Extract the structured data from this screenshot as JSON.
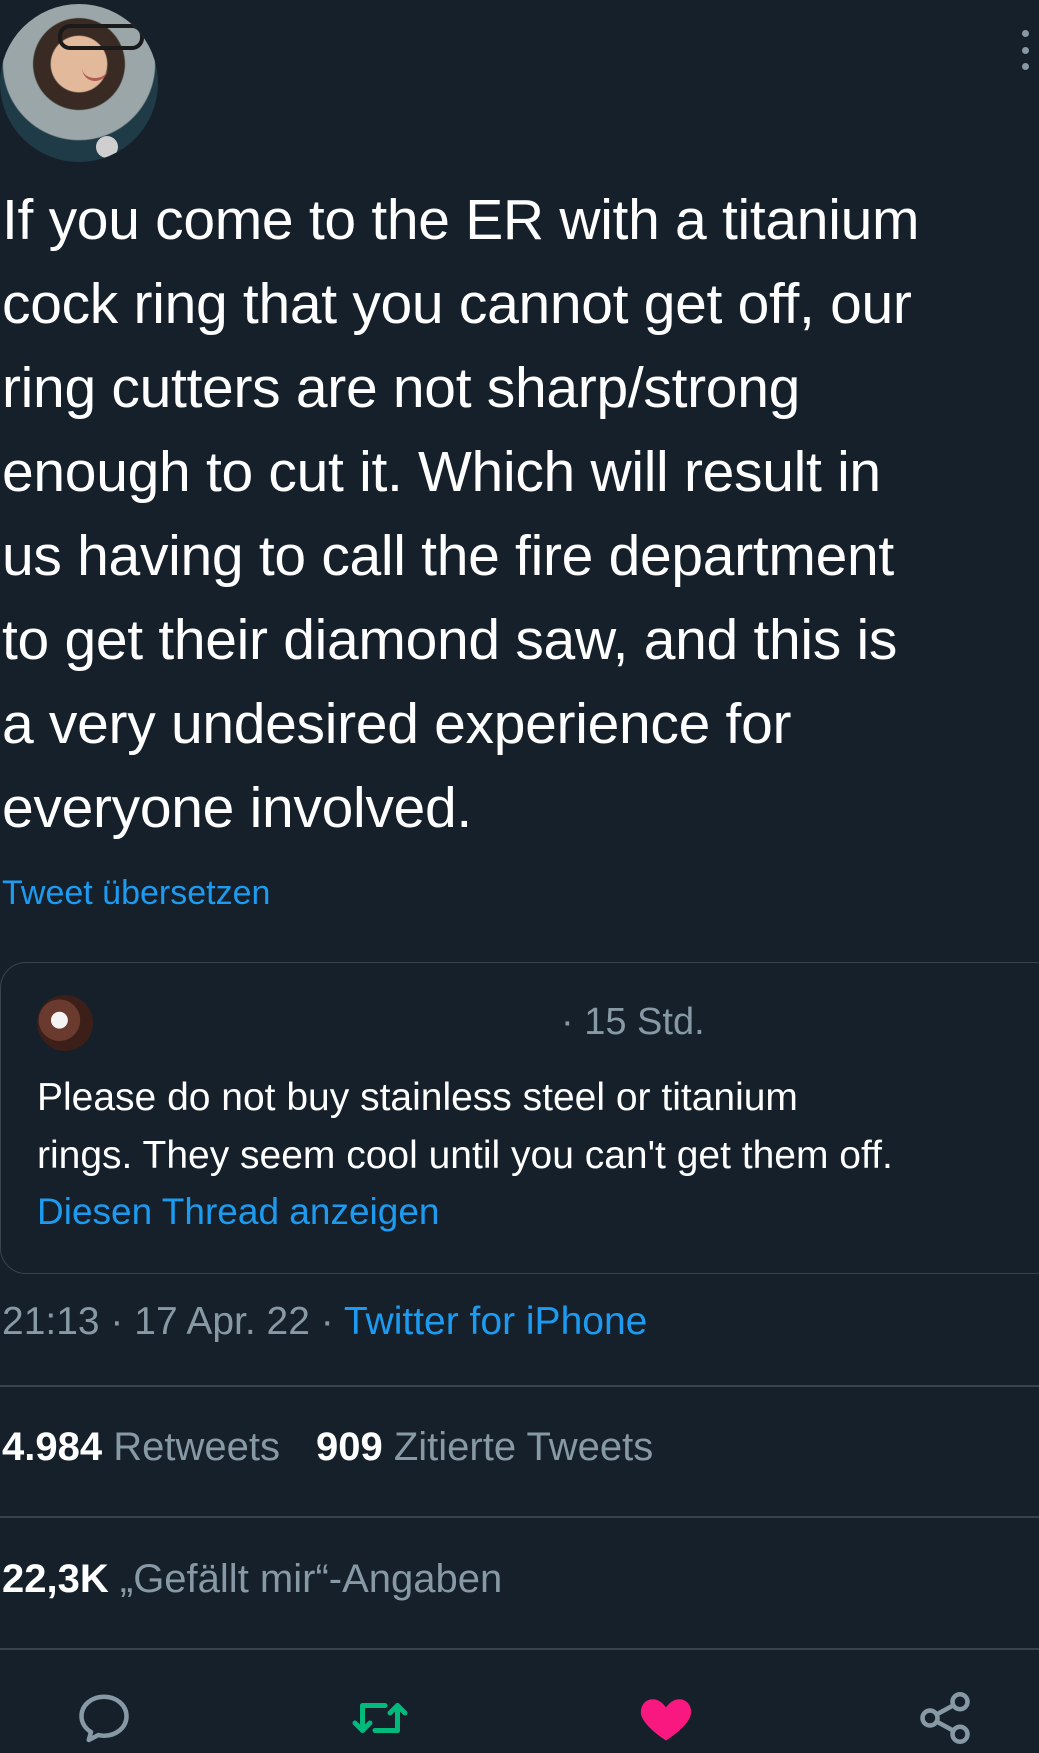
{
  "tweet": {
    "text": "If you come to the ER with a titanium\ncock ring that you cannot get off, our\nring cutters are not sharp/strong\nenough to cut it. Which will result in\nus having to call the fire department\nto get their diamond saw, and this is\na very undesired experience for\neveryone involved.",
    "translate_label": "Tweet übersetzen"
  },
  "quote": {
    "time": "· 15 Std.",
    "text": "Please do not buy stainless steel or titanium\nrings. They seem cool until you can't get them off.",
    "thread_label": "Diesen Thread anzeigen"
  },
  "meta": {
    "time_date": "21:13 · 17 Apr. 22 · ",
    "source": "Twitter for iPhone"
  },
  "stats": {
    "retweets_count": "4.984",
    "retweets_label": "Retweets",
    "quotes_count": "909",
    "quotes_label": "Zitierte Tweets",
    "likes_count": "22,3K",
    "likes_label": "„Gefällt mir“-Angaben"
  },
  "colors": {
    "background": "#15202b",
    "link": "#1d9bf0",
    "muted": "#8899a6",
    "retweet_green": "#00ba7c",
    "like_pink": "#f91880"
  },
  "icons": {
    "more": "more-vertical-icon",
    "reply": "reply-icon",
    "retweet": "retweet-icon",
    "like": "heart-icon",
    "share": "share-icon"
  }
}
